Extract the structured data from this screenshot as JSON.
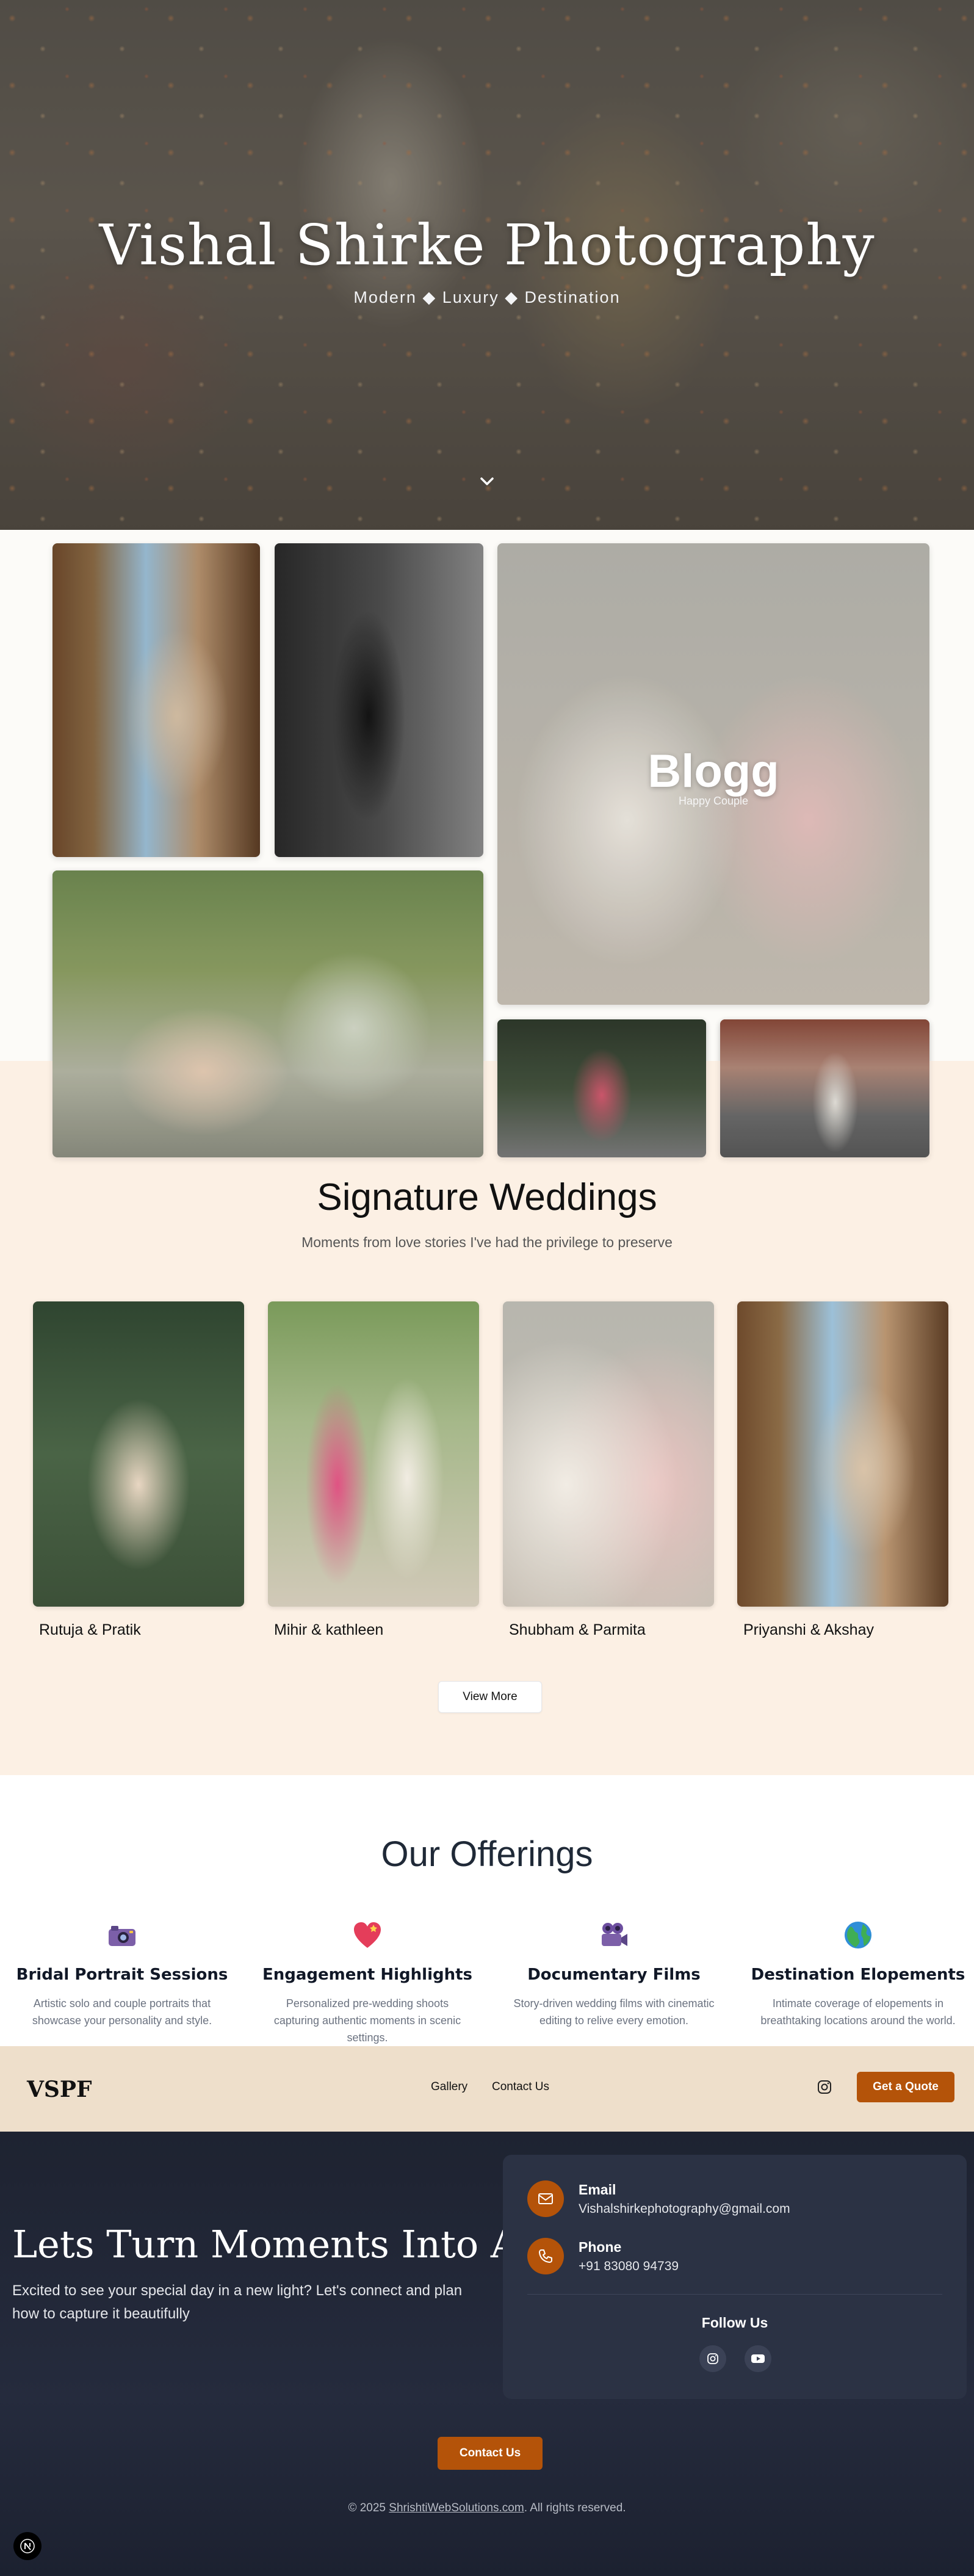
{
  "hero": {
    "title": "Vishal Shirke Photography",
    "subtitle": "Modern ◆ Luxury ◆ Destination",
    "scroll_icon": "chevron-down-icon"
  },
  "gallery": {
    "featured": {
      "title": "Blogg",
      "subtitle": "Happy Couple"
    }
  },
  "signature": {
    "heading": "Signature Weddings",
    "subheading": "Moments from love stories I've had the privilege to preserve",
    "couples": [
      {
        "name": "Rutuja & Pratik"
      },
      {
        "name": "Mihir & kathleen"
      },
      {
        "name": "Shubham & Parmita"
      },
      {
        "name": "Priyanshi & Akshay"
      }
    ],
    "view_more_label": "View More"
  },
  "offerings": {
    "heading": "Our Offerings",
    "items": [
      {
        "icon": "camera-icon",
        "title": "Bridal Portrait Sessions",
        "description": "Artistic solo and couple portraits that showcase your personality and style."
      },
      {
        "icon": "heart-icon",
        "title": "Engagement Highlights",
        "description": "Personalized pre-wedding shoots capturing authentic moments in scenic settings."
      },
      {
        "icon": "film-camera-icon",
        "title": "Documentary Films",
        "description": "Story-driven wedding films with cinematic editing to relive every emotion."
      },
      {
        "icon": "globe-icon",
        "title": "Destination Elopements",
        "description": "Intimate coverage of elopements in breathtaking locations around the world."
      }
    ]
  },
  "navbar": {
    "logo": "VSPF",
    "links": [
      "Gallery",
      "Contact Us"
    ],
    "instagram_icon": "instagram-icon",
    "quote_label": "Get a Quote"
  },
  "contact": {
    "title": "Lets Turn Moments Into Art",
    "text": "Excited to see your special day in a new light? Let's connect and plan how to capture it beautifully",
    "email_label": "Email",
    "email_value": "Vishalshirkephotography@gmail.com",
    "phone_label": "Phone",
    "phone_value": "+91 83080 94739",
    "follow_label": "Follow Us",
    "contact_button": "Contact Us",
    "copyright_prefix": "© 2025 ",
    "copyright_link": "ShrishtiWebSolutions.com",
    "copyright_suffix": ". All rights reserved."
  },
  "colors": {
    "accent": "#b45309",
    "signature_bg": "#fcf0e4",
    "navbar_bg": "#eedfcb",
    "footer_bg": "#1e2331"
  }
}
